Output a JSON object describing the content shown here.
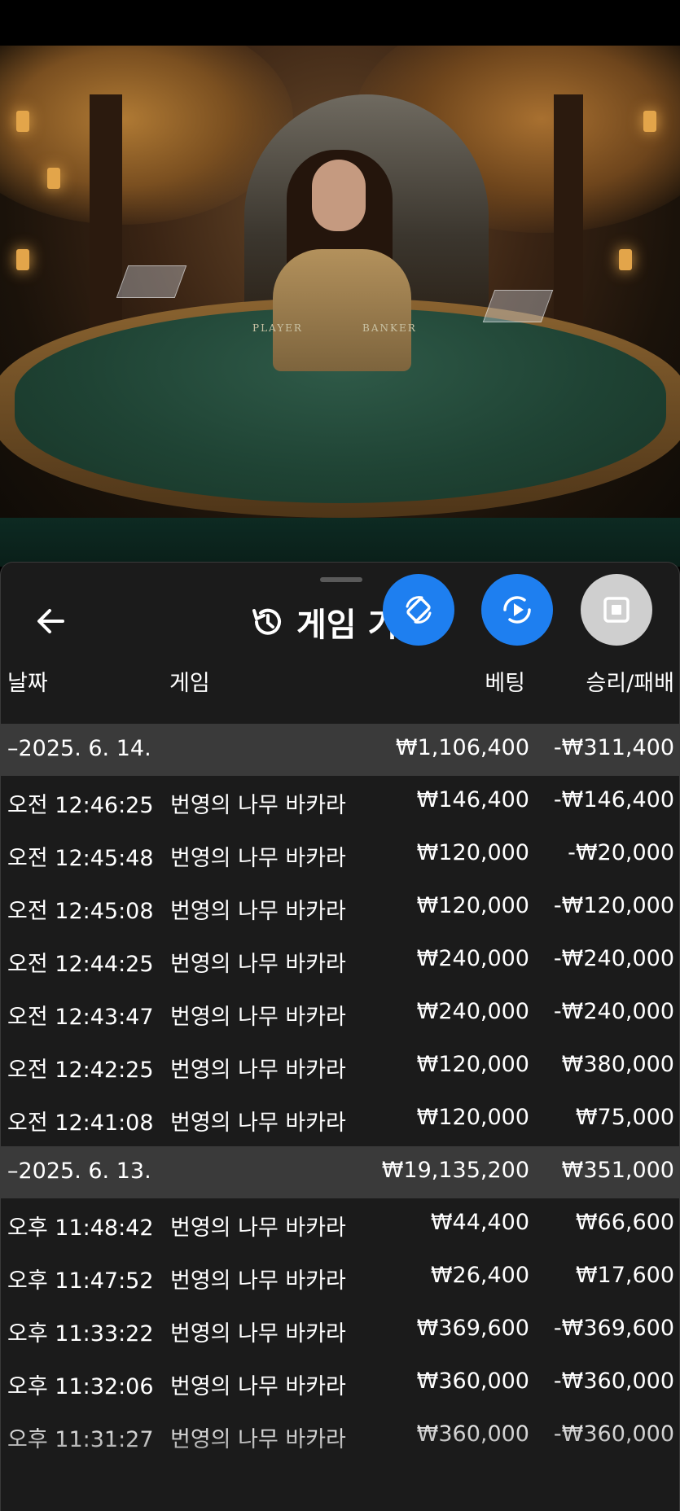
{
  "header": {
    "title": "게임 기",
    "back_icon": "arrow-left-icon",
    "history_icon": "history-clock-icon"
  },
  "actions": [
    {
      "icon": "rotate-device-icon",
      "color": "#1e7ff0"
    },
    {
      "icon": "replay-play-icon",
      "color": "#1e7ff0"
    },
    {
      "icon": "stop-square-icon",
      "color": "#cfcfcf"
    }
  ],
  "columns": {
    "date": "날짜",
    "game": "게임",
    "bet": "베팅",
    "result": "승리/패배"
  },
  "video": {
    "table_left": "PLAYER",
    "table_right": "BANKER"
  },
  "groups": [
    {
      "date": "–2025. 6. 14.",
      "bet_total": "₩1,106,400",
      "result_total": "-₩311,400",
      "rows": [
        {
          "time": "오전 12:46:25",
          "game": "번영의 나무 바카라",
          "bet": "₩146,400",
          "result": "-₩146,400"
        },
        {
          "time": "오전 12:45:48",
          "game": "번영의 나무 바카라",
          "bet": "₩120,000",
          "result": "-₩20,000"
        },
        {
          "time": "오전 12:45:08",
          "game": "번영의 나무 바카라",
          "bet": "₩120,000",
          "result": "-₩120,000"
        },
        {
          "time": "오전 12:44:25",
          "game": "번영의 나무 바카라",
          "bet": "₩240,000",
          "result": "-₩240,000"
        },
        {
          "time": "오전 12:43:47",
          "game": "번영의 나무 바카라",
          "bet": "₩240,000",
          "result": "-₩240,000"
        },
        {
          "time": "오전 12:42:25",
          "game": "번영의 나무 바카라",
          "bet": "₩120,000",
          "result": "₩380,000"
        },
        {
          "time": "오전 12:41:08",
          "game": "번영의 나무 바카라",
          "bet": "₩120,000",
          "result": "₩75,000"
        }
      ]
    },
    {
      "date": "–2025. 6. 13.",
      "bet_total": "₩19,135,200",
      "result_total": "₩351,000",
      "rows": [
        {
          "time": "오후 11:48:42",
          "game": "번영의 나무 바카라",
          "bet": "₩44,400",
          "result": "₩66,600"
        },
        {
          "time": "오후 11:47:52",
          "game": "번영의 나무 바카라",
          "bet": "₩26,400",
          "result": "₩17,600"
        },
        {
          "time": "오후 11:33:22",
          "game": "번영의 나무 바카라",
          "bet": "₩369,600",
          "result": "-₩369,600"
        },
        {
          "time": "오후 11:32:06",
          "game": "번영의 나무 바카라",
          "bet": "₩360,000",
          "result": "-₩360,000"
        },
        {
          "time": "오후 11:31:27",
          "game": "번영의 나무 바카라",
          "bet": "₩360,000",
          "result": "-₩360,000"
        }
      ]
    }
  ]
}
